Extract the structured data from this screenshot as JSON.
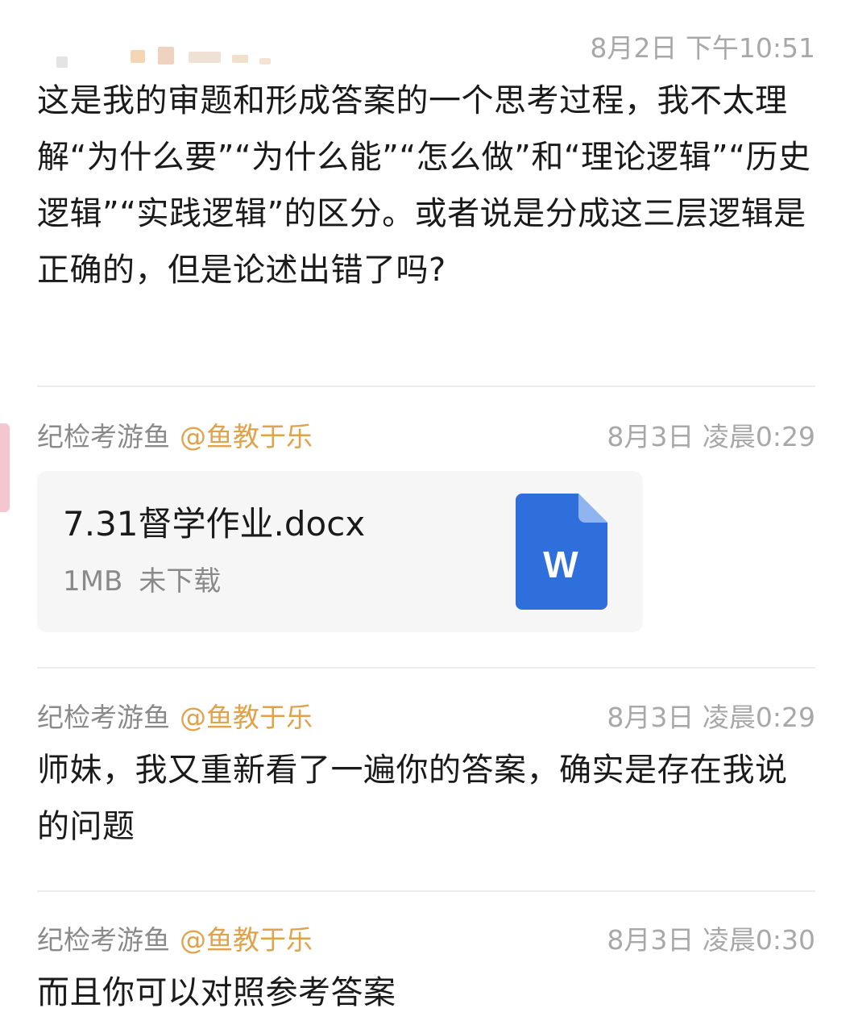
{
  "messages": [
    {
      "time": "8月2日 下午10:51",
      "text": "这是我的审题和形成答案的一个思考过程，我不太理解“为什么要”“为什么能”“怎么做”和“理论逻辑”“历史逻辑”“实践逻辑”的区分。或者说是分成这三层逻辑是正确的，但是论述出错了吗?"
    },
    {
      "sender": "纪检考游鱼",
      "mention": "@鱼教于乐",
      "time": "8月3日 凌晨0:29",
      "file": {
        "name": "7.31督学作业.docx",
        "size": "1MB",
        "status": "未下载",
        "icon": "word-doc-icon",
        "icon_letter": "W",
        "icon_color": "#2f6fdb"
      }
    },
    {
      "sender": "纪检考游鱼",
      "mention": "@鱼教于乐",
      "time": "8月3日 凌晨0:29",
      "text": "师妹，我又重新看了一遍你的答案，确实是存在我说的问题"
    },
    {
      "sender": "纪检考游鱼",
      "mention": "@鱼教于乐",
      "time": "8月3日 凌晨0:30",
      "text": "而且你可以对照参考答案"
    }
  ],
  "colors": {
    "mention": "#e0a24a",
    "sender": "#8a8a8a",
    "time": "#a8a8a8",
    "divider": "#ececec",
    "file_card_bg": "#f6f6f6"
  }
}
